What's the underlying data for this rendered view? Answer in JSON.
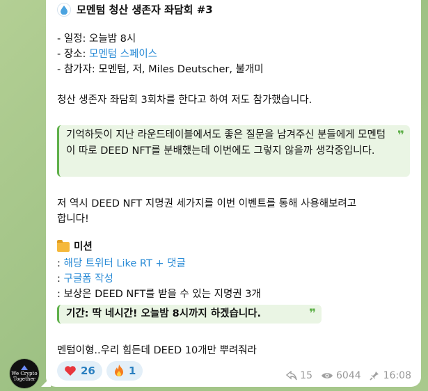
{
  "message": {
    "title": "모멘텀 청산 생존자 좌담회 #3",
    "details": {
      "time_prefix": "- 일정: 오늘밤 8시",
      "place_prefix": "- 장소: ",
      "place_link": "모멘텀 스페이스",
      "participants": "- 참가자: 모멘텀, 저, Miles Deutscher, 불개미"
    },
    "intro": "청산 생존자 좌담회 3회차를 한다고 하여 저도 참가했습니다.",
    "quote1": {
      "text": "기억하듯이 지난 라운드테이블에서도 좋은 질문을 남겨주신 분들에게 모멘텀이 따로 DEED NFT를 분배했는데 이번에도 그렇지 않을까 생각중입니다."
    },
    "nft_line1": "저 역시 DEED NFT 지명권 세가지를 이번 이벤트를 통해 사용해보려고",
    "nft_line2": "합니다!",
    "mission": {
      "title": "미션",
      "item1_prefix": ": ",
      "item1_link": "해당 트위터 Like RT + 댓글",
      "item2_prefix": ": ",
      "item2_link": "구글폼 작성",
      "item3": ": 보상은 DEED NFT를 받을 수 있는 지명권 3개"
    },
    "quote2": {
      "text": "기간: 딱 네시간! 오늘밤 8시까지 하겠습니다."
    },
    "closing": "멘텀이형..우리 힘든데 DEED 10개만 뿌려줘라"
  },
  "avatar": {
    "text_line1": "We Crypto",
    "text_line2": "Together"
  },
  "reactions": [
    {
      "emoji": "heart-icon",
      "count": "26"
    },
    {
      "emoji": "fire-icon",
      "count": "1"
    }
  ],
  "meta": {
    "forwards": "15",
    "views": "6044",
    "time": "16:08"
  },
  "colors": {
    "accent": "#2a8bd6",
    "quote_bar": "#5fb04a",
    "bubble": "#ffffff"
  }
}
